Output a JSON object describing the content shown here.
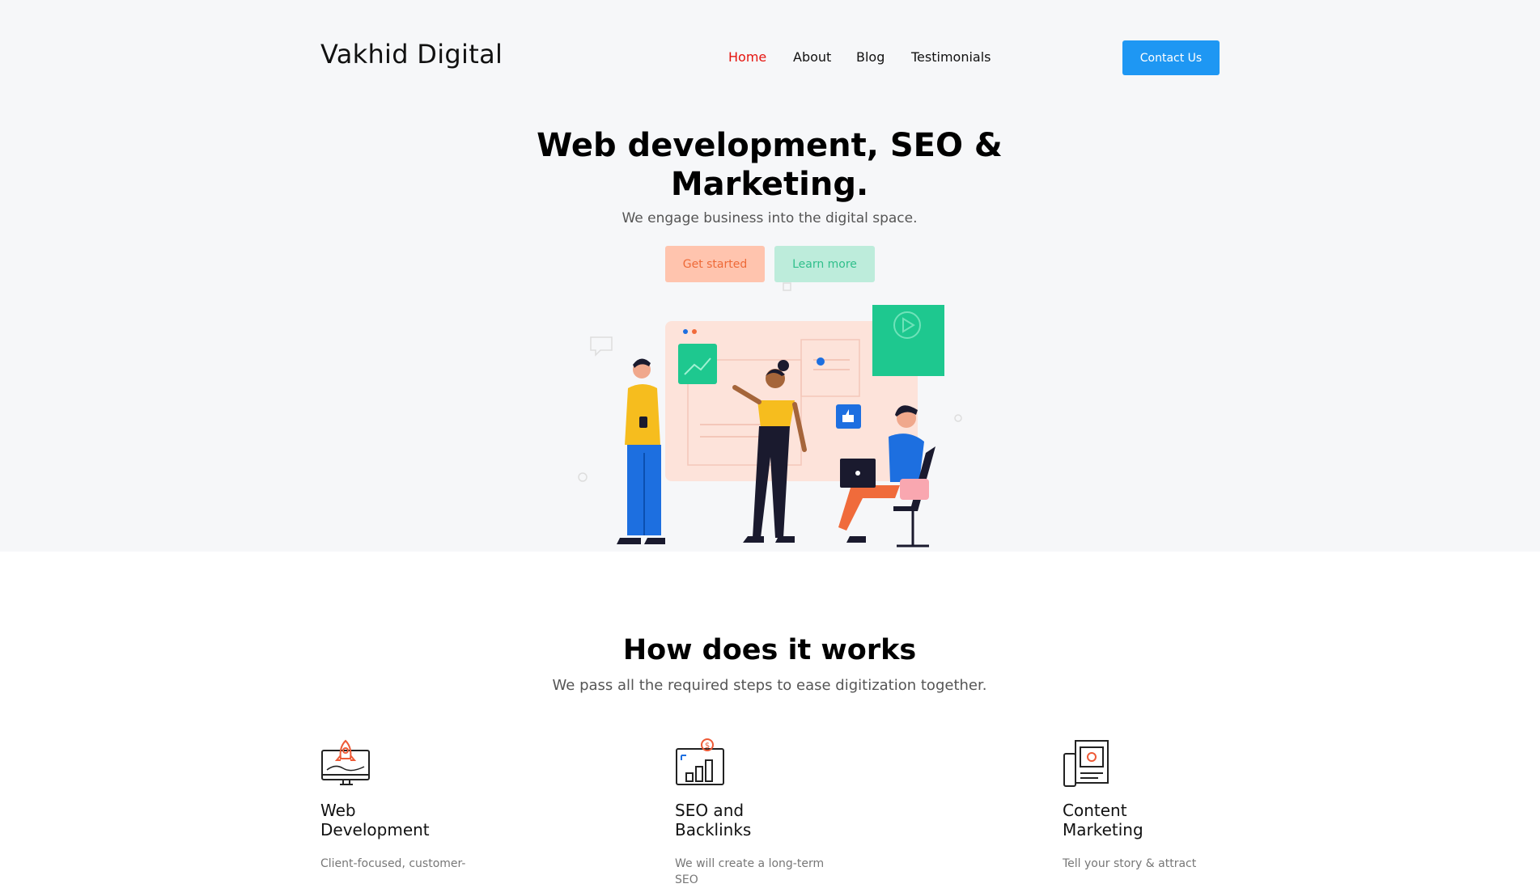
{
  "header": {
    "brand": "Vakhid Digital",
    "nav": [
      "Home",
      "About",
      "Blog",
      "Testimonials"
    ],
    "active_nav": "Home",
    "contact_label": "Contact Us",
    "accent_color": "#1e97f3",
    "active_color": "#e5140f"
  },
  "hero": {
    "title": "Web development, SEO & Marketing.",
    "subtitle": "We engage business into the digital space.",
    "primary_cta": "Get started",
    "secondary_cta": "Learn more",
    "illustration_icon": "team-collaboration-illustration"
  },
  "how": {
    "title": "How does it works",
    "subtitle": "We pass all the required steps to ease digitization together.",
    "features": [
      {
        "icon": "rocket-monitor-icon",
        "title": "Web Development",
        "desc": "Client-focused, customer-"
      },
      {
        "icon": "seo-chart-icon",
        "title": "SEO and Backlinks",
        "desc": "We will create a long-term SEO"
      },
      {
        "icon": "content-document-icon",
        "title": "Content Marketing",
        "desc": "Tell your story & attract"
      }
    ]
  }
}
